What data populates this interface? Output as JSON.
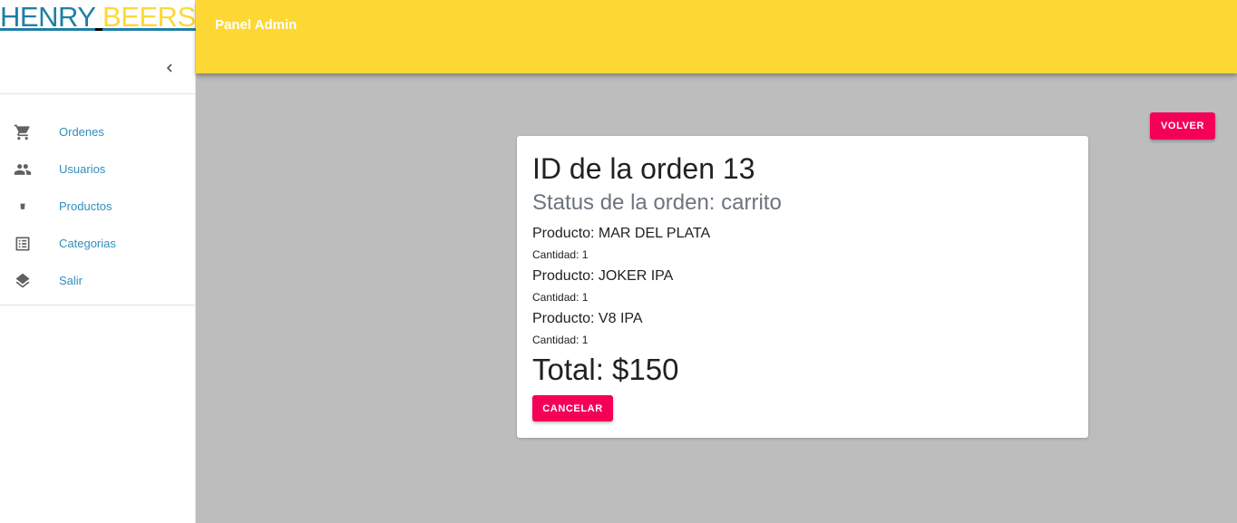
{
  "sidebar": {
    "brand": {
      "part1": "HENRY",
      "part2": "BEERS"
    },
    "items": [
      {
        "label": "Ordenes",
        "icon": "cart-icon"
      },
      {
        "label": "Usuarios",
        "icon": "people-icon"
      },
      {
        "label": "Productos",
        "icon": "beer-icon"
      },
      {
        "label": "Categorias",
        "icon": "list-icon"
      },
      {
        "label": "Salir",
        "icon": "layers-icon"
      }
    ]
  },
  "appbar": {
    "title": "Panel Admin"
  },
  "actions": {
    "volver_label": "VOLVER"
  },
  "order": {
    "title": "ID de la orden 13",
    "status": "Status de la orden: carrito",
    "items": [
      {
        "name": "Producto: MAR DEL PLATA",
        "qty": "Cantidad: 1"
      },
      {
        "name": "Producto: JOKER IPA",
        "qty": "Cantidad: 1"
      },
      {
        "name": "Producto: V8 IPA",
        "qty": "Cantidad: 1"
      }
    ],
    "total": "Total: $150",
    "cancel_label": "CANCELAR"
  },
  "colors": {
    "appbar": "#fdd835",
    "accent": "#f50057",
    "brand_blue": "#1f7fa6",
    "link": "#2f8fbd",
    "background": "#bdbdbd"
  }
}
